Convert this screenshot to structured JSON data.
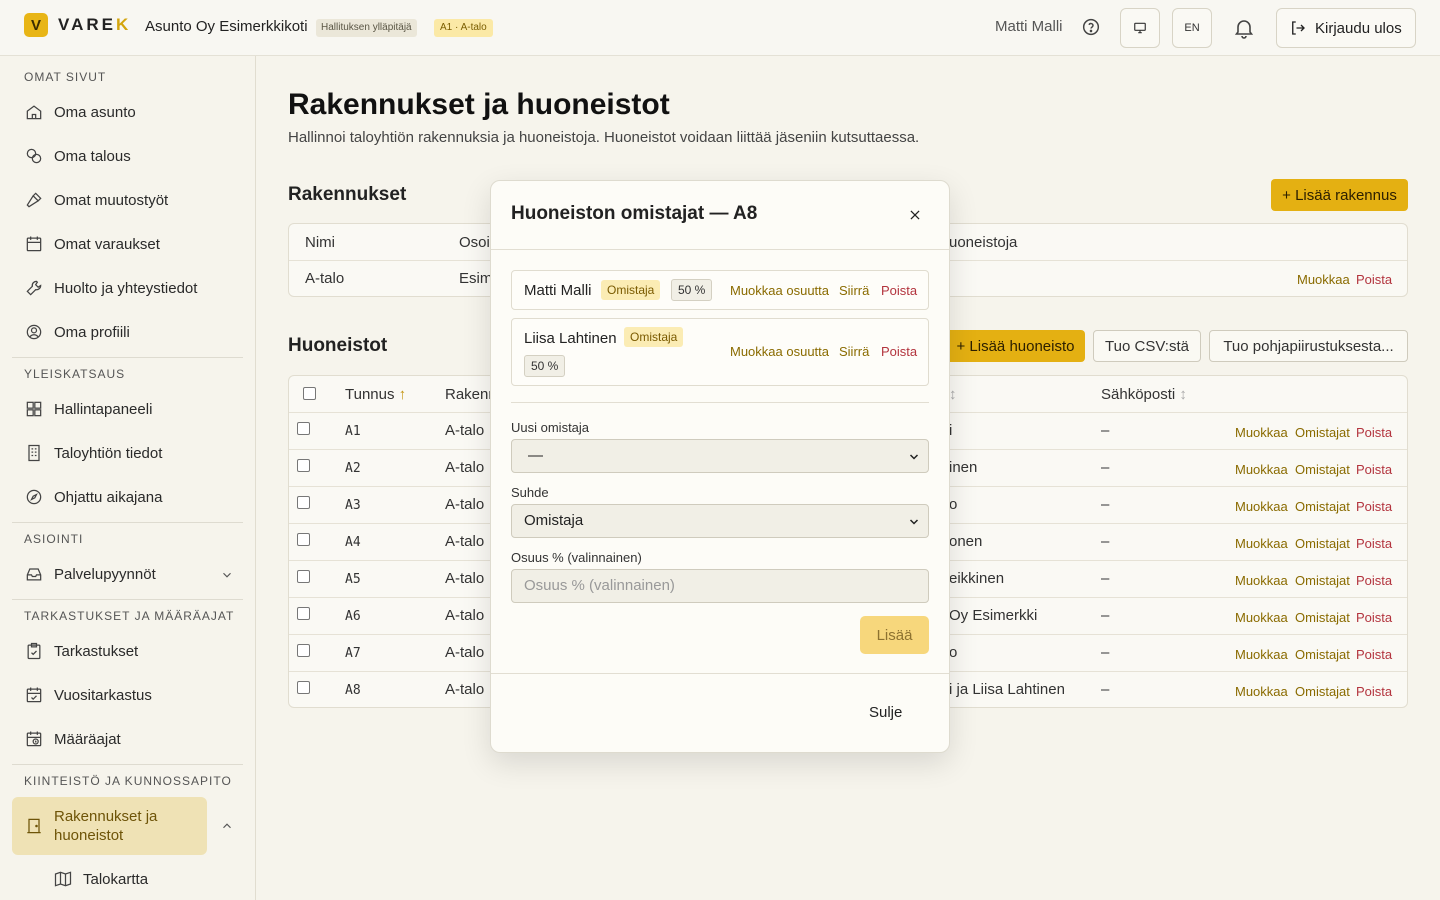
{
  "header": {
    "logo_letter": "V",
    "brand_main": "VARE",
    "brand_accent": "K",
    "org_name": "Asunto Oy Esimerkkikoti",
    "role_badge": "Hallituksen ylläpitäjä",
    "unit_badge": "A1 · A-talo",
    "user": "Matti Malli",
    "lang": "EN",
    "logout": "Kirjaudu ulos"
  },
  "sidebar": {
    "sections": [
      {
        "title": "OMAT SIVUT",
        "items": [
          "Oma asunto",
          "Oma talous",
          "Omat muutostyöt",
          "Omat varaukset",
          "Huolto ja yhteystiedot",
          "Oma profiili"
        ]
      },
      {
        "title": "YLEISKATSAUS",
        "items": [
          "Hallintapaneeli",
          "Taloyhtiön tiedot",
          "Ohjattu aikajana"
        ]
      },
      {
        "title": "ASIOINTI",
        "items": [
          "Palvelupyynnöt"
        ]
      },
      {
        "title": "TARKASTUKSET JA MÄÄRÄAJAT",
        "items": [
          "Tarkastukset",
          "Vuositarkastus",
          "Määräajat"
        ]
      },
      {
        "title": "KIINTEISTÖ JA KUNNOSSAPITO",
        "items": [
          "Rakennukset ja huoneistot",
          "Talokartta"
        ]
      }
    ],
    "active_line1": "Rakennukset ja",
    "active_line2": "huoneistot"
  },
  "main": {
    "title": "Rakennukset ja huoneistot",
    "subtitle": "Hallinnoi taloyhtiön rakennuksia ja huoneistoja. Huoneistot voidaan liittää jäseniin kutsuttaessa.",
    "buildings": {
      "heading": "Rakennukset",
      "add": "+ Lisää rakennus",
      "col_name": "Nimi",
      "col_address": "Osoi",
      "col_units": "uoneistoja",
      "row": {
        "name": "A-talo",
        "address": "Esim",
        "edit": "Muokkaa",
        "delete": "Poista"
      }
    },
    "units": {
      "heading": "Huoneistot",
      "add": "+ Lisää huoneisto",
      "import_csv": "Tuo CSV:stä",
      "import_plan": "Tuo pohjapiirustuksesta...",
      "col_id": "Tunnus",
      "col_building": "Rakenn",
      "col_email": "Sähköposti",
      "rows": [
        {
          "id": "A1",
          "building": "A-talo",
          "owner": "i",
          "email": "–"
        },
        {
          "id": "A2",
          "building": "A-talo",
          "owner": "inen",
          "email": "–"
        },
        {
          "id": "A3",
          "building": "A-talo",
          "owner": "o",
          "email": "–"
        },
        {
          "id": "A4",
          "building": "A-talo",
          "owner": "onen",
          "email": "–"
        },
        {
          "id": "A5",
          "building": "A-talo",
          "owner": "eikkinen",
          "email": "–"
        },
        {
          "id": "A6",
          "building": "A-talo",
          "owner": "Oy Esimerkki",
          "email": "–"
        },
        {
          "id": "A7",
          "building": "A-talo",
          "owner": "o",
          "email": "–"
        },
        {
          "id": "A8",
          "building": "A-talo",
          "owner": "i ja Liisa Lahtinen",
          "email": "–"
        }
      ],
      "act_edit": "Muokkaa",
      "act_owners": "Omistajat",
      "act_delete": "Poista"
    }
  },
  "modal": {
    "title": "Huoneiston omistajat — A8",
    "owners": [
      {
        "name": "Matti Malli",
        "role": "Omistaja",
        "share": "50 %",
        "edit": "Muokkaa osuutta",
        "move": "Siirrä",
        "remove": "Poista"
      },
      {
        "name": "Liisa Lahtinen",
        "role": "Omistaja",
        "share": "50 %",
        "edit": "Muokkaa osuutta",
        "move": "Siirrä",
        "remove": "Poista"
      }
    ],
    "new_owner_label": "Uusi omistaja",
    "new_owner_value": "—",
    "relation_label": "Suhde",
    "relation_value": "Omistaja",
    "share_label": "Osuus % (valinnainen)",
    "share_placeholder": "Osuus % (valinnainen)",
    "add": "Lisää",
    "close": "Sulje"
  },
  "colors": {
    "accent": "#e4b012",
    "danger": "#b3343e",
    "link": "#8a6b00"
  }
}
